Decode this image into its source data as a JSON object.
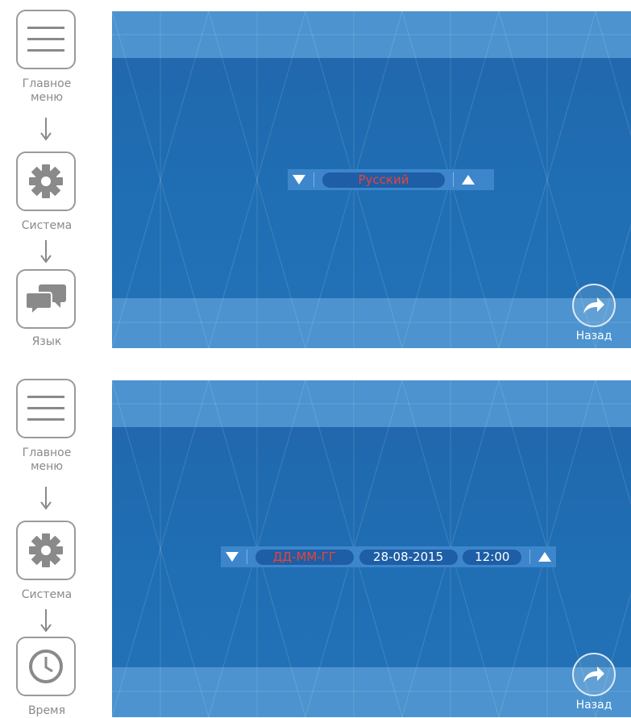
{
  "colors": {
    "screen_blue": "#1f6bb0",
    "band_blue": "#4c93cf",
    "selector_blue": "#3d86cc",
    "pill_blue": "#1e5ea6",
    "highlight_red": "#e8433a",
    "nav_gray": "#8a8a8a"
  },
  "panel_language": {
    "nav": {
      "main_menu_label": "Главное меню",
      "main_menu_icon": "menu-lines-icon",
      "system_label": "Система",
      "system_icon": "gear-icon",
      "item_label": "Язык",
      "item_icon": "chat-bubbles-icon"
    },
    "selector": {
      "value": "Русский"
    },
    "back_label": "Назад"
  },
  "panel_time": {
    "nav": {
      "main_menu_label": "Главное меню",
      "main_menu_icon": "menu-lines-icon",
      "system_label": "Система",
      "system_icon": "gear-icon",
      "item_label": "Время",
      "item_icon": "clock-icon"
    },
    "selector": {
      "format": "ДД-ММ-ГГ",
      "date": "28-08-2015",
      "time": "12:00"
    },
    "back_label": "Назад"
  }
}
